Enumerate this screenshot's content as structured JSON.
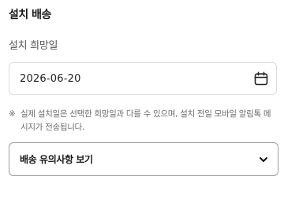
{
  "section": {
    "title": "설치 배송"
  },
  "install_date": {
    "label": "설치 희망일",
    "value": "2026-06-20",
    "icon": "calendar-icon"
  },
  "notice": {
    "mark": "※",
    "text": "실제 설치일은 선택한 희망일과 다를 수 있으며, 설치 전일 모바일 알림톡 메시지가 전송됩니다."
  },
  "delivery_notes": {
    "label": "배송 유의사항 보기",
    "icon": "chevron-down-icon"
  },
  "colors": {
    "text_primary": "#222222",
    "text_secondary": "#6b6b6b",
    "field_border": "#dcdcdc",
    "dropdown_border": "#9e9e9e"
  }
}
